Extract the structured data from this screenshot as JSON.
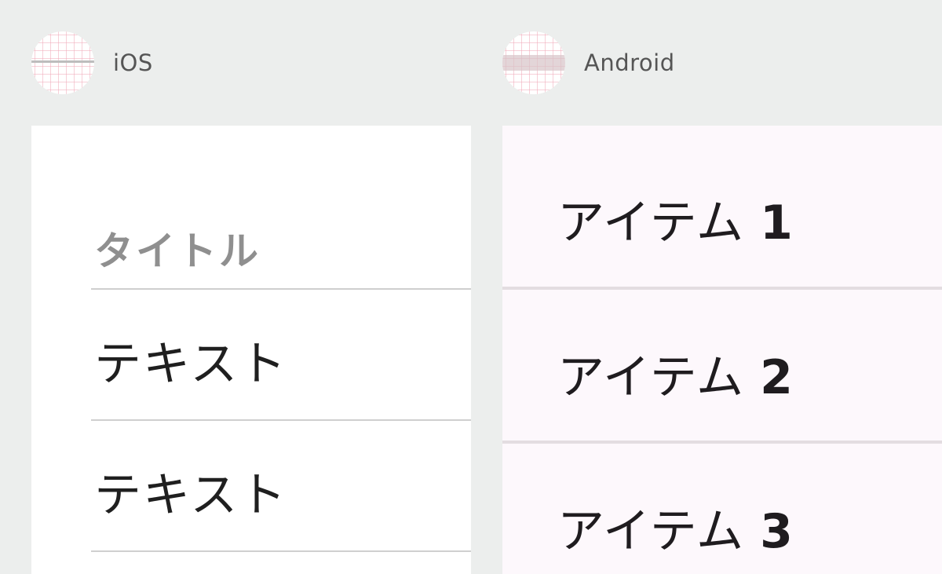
{
  "ios": {
    "label": "iOS",
    "section_title": "タイトル",
    "rows": [
      {
        "text": "テキスト"
      },
      {
        "text": "テキスト"
      }
    ]
  },
  "android": {
    "label": "Android",
    "items": [
      {
        "text": "アイテム",
        "number": "1"
      },
      {
        "text": "アイテム",
        "number": "2"
      },
      {
        "text": "アイテム",
        "number": "3"
      }
    ]
  },
  "colors": {
    "page_background": "#eceeed",
    "ios_panel_background": "#ffffff",
    "android_panel_background": "#fdf8fc",
    "grid_line": "#f0aab9",
    "divider": "#cfcfcf"
  },
  "icons": {
    "ios_icon": "ios-grid-list-icon",
    "android_icon": "android-grid-list-icon"
  }
}
